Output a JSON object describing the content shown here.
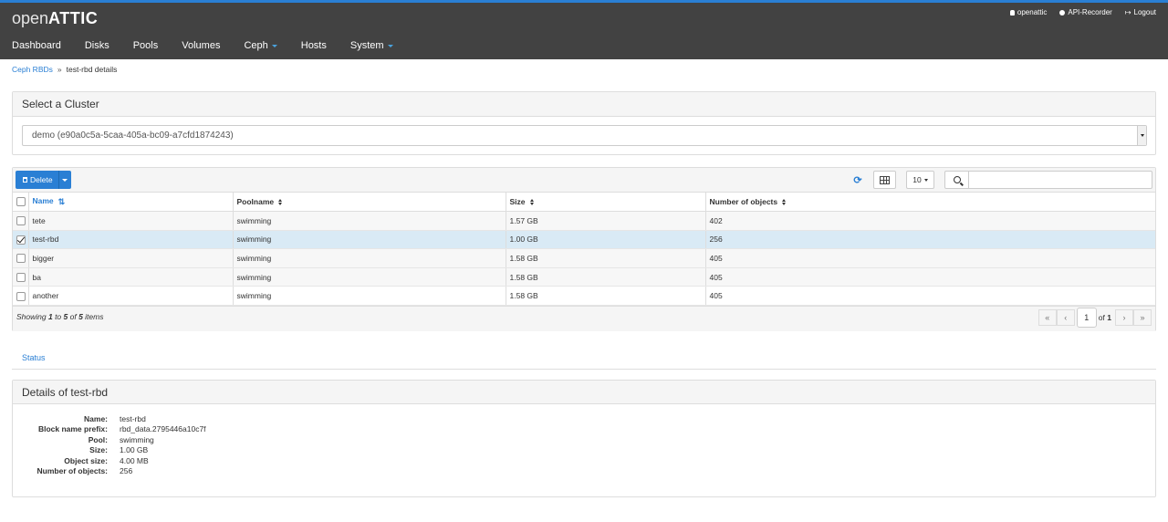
{
  "app": {
    "logo_light": "open",
    "logo_bold": "ATTIC",
    "user": "openattic",
    "api_recorder": "API-Recorder",
    "logout": "Logout"
  },
  "nav": [
    {
      "label": "Dashboard"
    },
    {
      "label": "Disks"
    },
    {
      "label": "Pools"
    },
    {
      "label": "Volumes"
    },
    {
      "label": "Ceph",
      "dropdown": true
    },
    {
      "label": "Hosts"
    },
    {
      "label": "System",
      "dropdown": true
    }
  ],
  "breadcrumb": {
    "parent": "Ceph RBDs",
    "separator": "»",
    "current": "test-rbd details"
  },
  "cluster": {
    "title": "Select a Cluster",
    "selected": "demo (e90a0c5a-5caa-405a-bc09-a7cfd1874243)"
  },
  "toolbar": {
    "delete_label": "Delete",
    "page_size": "10",
    "search_value": ""
  },
  "table": {
    "columns": [
      "Name",
      "Poolname",
      "Size",
      "Number of objects"
    ],
    "rows": [
      {
        "name": "tete",
        "pool": "swimming",
        "size": "1.57 GB",
        "objects": "402",
        "checked": false
      },
      {
        "name": "test-rbd",
        "pool": "swimming",
        "size": "1.00 GB",
        "objects": "256",
        "checked": true
      },
      {
        "name": "bigger",
        "pool": "swimming",
        "size": "1.58 GB",
        "objects": "405",
        "checked": false
      },
      {
        "name": "ba",
        "pool": "swimming",
        "size": "1.58 GB",
        "objects": "405",
        "checked": false
      },
      {
        "name": "another",
        "pool": "swimming",
        "size": "1.58 GB",
        "objects": "405",
        "checked": false
      }
    ],
    "footer": {
      "showing_prefix": "Showing ",
      "from": "1",
      "to_word": " to ",
      "to": "5",
      "of_word": " of ",
      "total": "5",
      "suffix": " items"
    },
    "pager": {
      "page": "1",
      "of_label": "of",
      "pages": "1"
    }
  },
  "tabs": [
    {
      "label": "Status"
    }
  ],
  "details": {
    "title": "Details of test-rbd",
    "fields": [
      {
        "key": "Name:",
        "value": "test-rbd"
      },
      {
        "key": "Block name prefix:",
        "value": "rbd_data.2795446a10c7f"
      },
      {
        "key": "Pool:",
        "value": "swimming"
      },
      {
        "key": "Size:",
        "value": "1.00 GB"
      },
      {
        "key": "Object size:",
        "value": "4.00 MB"
      },
      {
        "key": "Number of objects:",
        "value": "256"
      }
    ]
  },
  "colors": {
    "accent": "#2a7fd4",
    "topbar": "#424242",
    "selected_row": "#d9eaf5"
  }
}
